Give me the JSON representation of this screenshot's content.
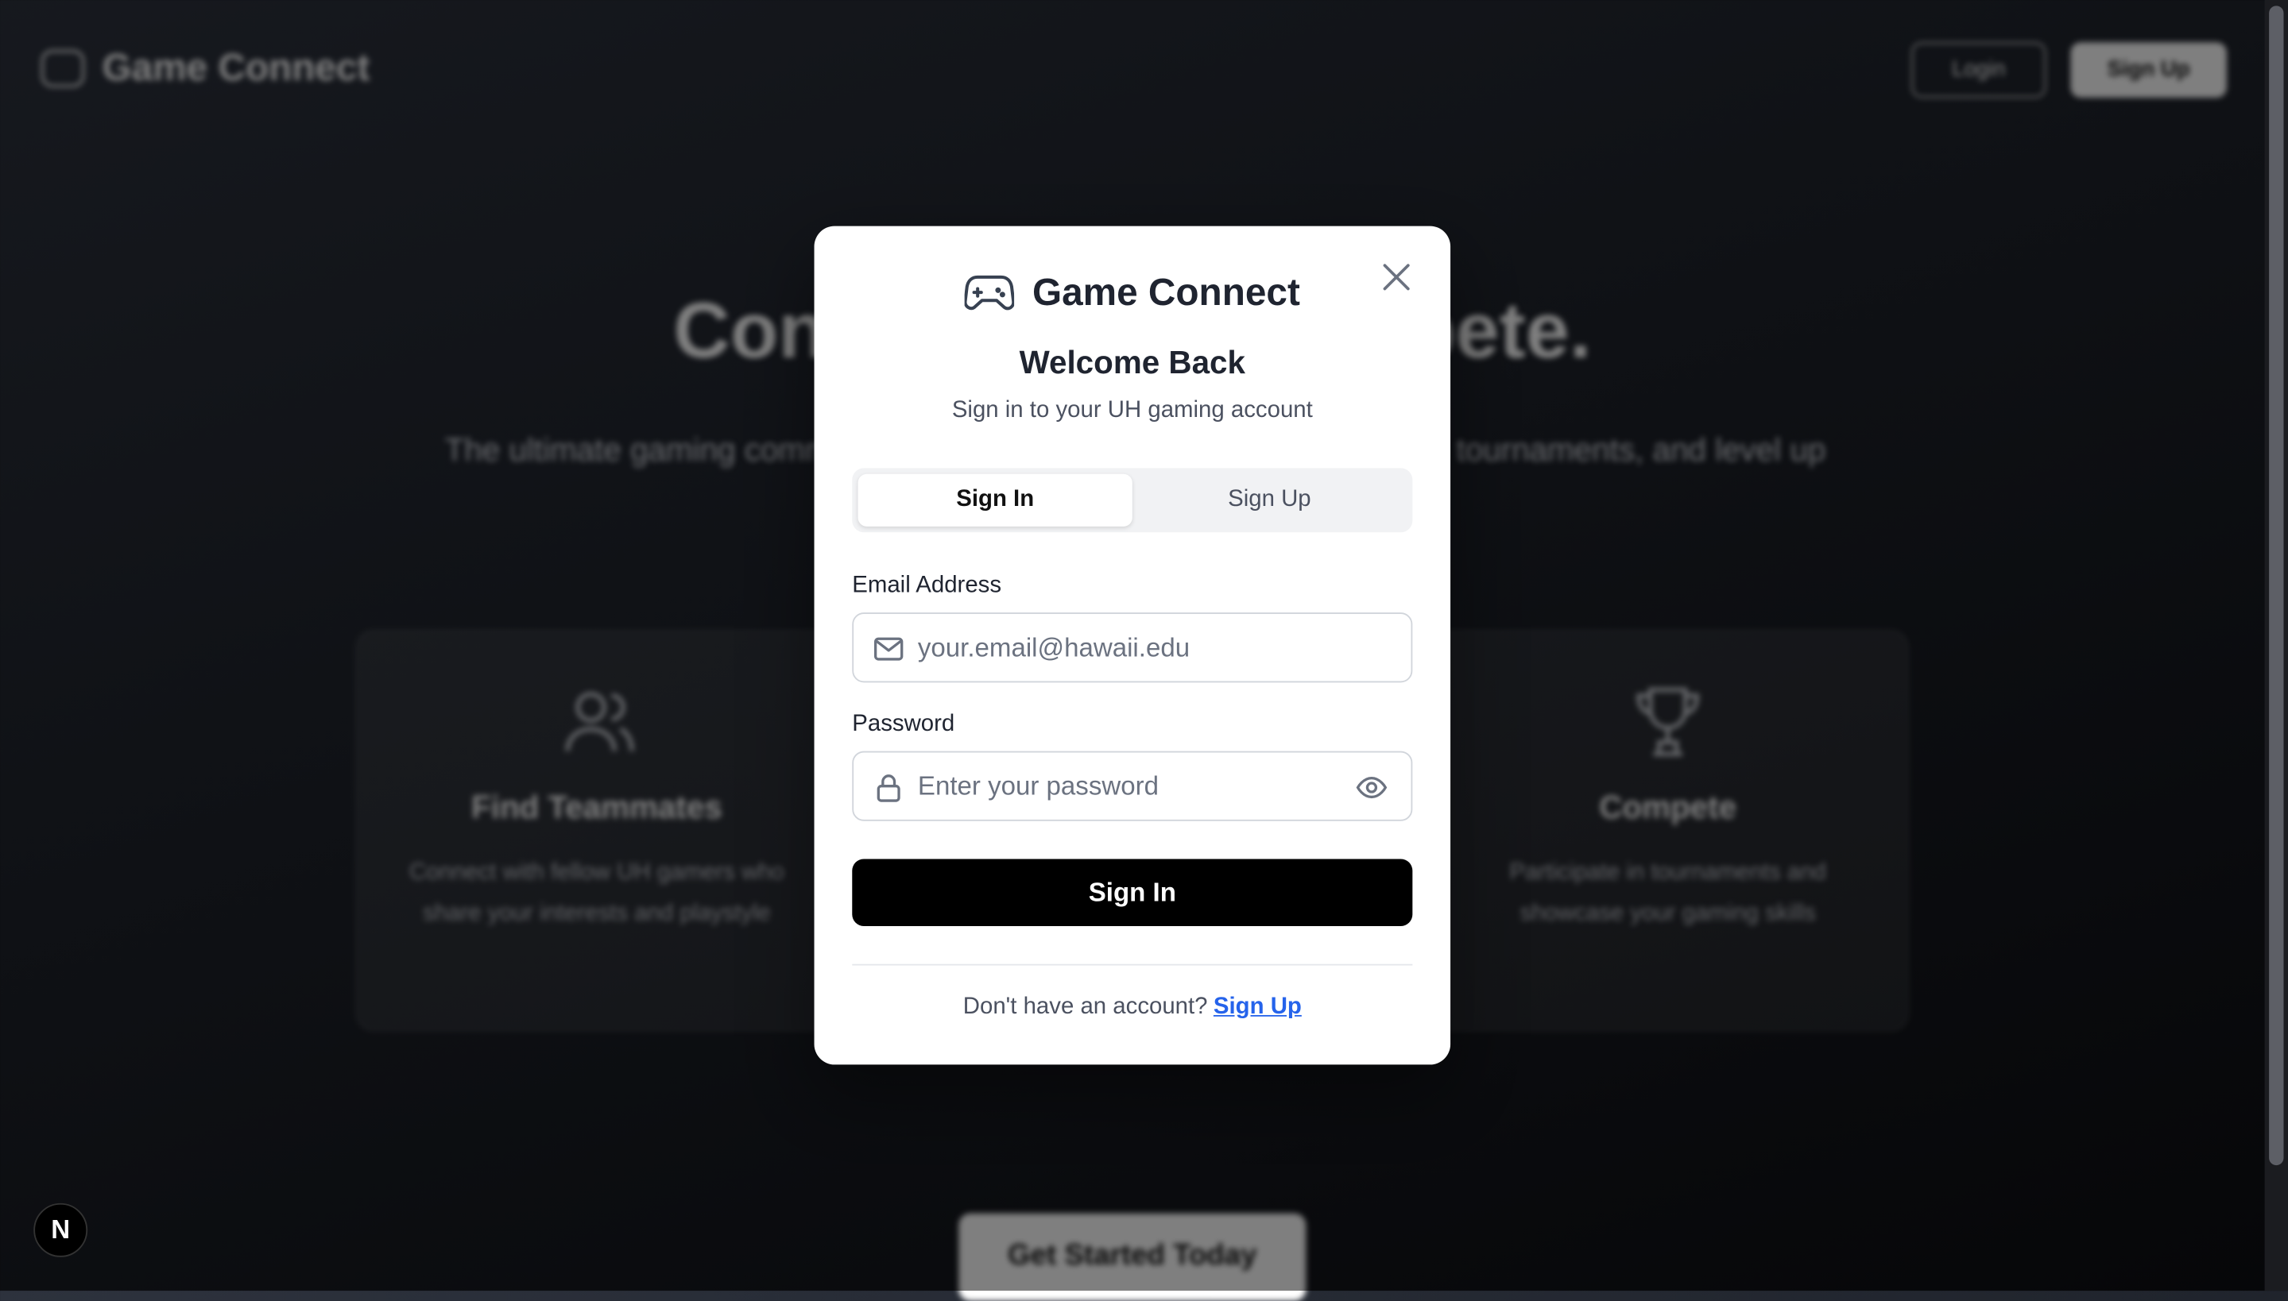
{
  "background": {
    "logo_text": "Game Connect",
    "nav_login": "Login",
    "nav_signup": "Sign Up",
    "hero_title": "Connect. Play. Compete.",
    "hero_subtitle": "The ultimate gaming community for UH students. Find teammates, join tournaments, and level up together.",
    "cards": [
      {
        "title": "Find Teammates",
        "description": "Connect with fellow UH gamers who share your interests and playstyle",
        "icon": "users-icon"
      },
      {
        "title": "Compete",
        "description": "Participate in tournaments and showcase your gaming skills",
        "icon": "trophy-icon"
      }
    ],
    "cta": "Get Started Today"
  },
  "modal": {
    "brand_text": "Game Connect",
    "brand_icon": "gamepad-icon",
    "welcome": "Welcome Back",
    "subtitle": "Sign in to your UH gaming account",
    "tabs": [
      {
        "label": "Sign In",
        "active": true
      },
      {
        "label": "Sign Up",
        "active": false
      }
    ],
    "email_label": "Email Address",
    "email_placeholder": "your.email@hawaii.edu",
    "email_value": "",
    "password_label": "Password",
    "password_placeholder": "Enter your password",
    "password_value": "",
    "submit_label": "Sign In",
    "footer_text": "Don't have an account?",
    "footer_link": "Sign Up"
  },
  "badge": {
    "text": "N"
  },
  "colors": {
    "accent": "#2563eb",
    "primary_button": "#000000",
    "modal_bg": "#ffffff",
    "page_bg": "#1e222a"
  }
}
